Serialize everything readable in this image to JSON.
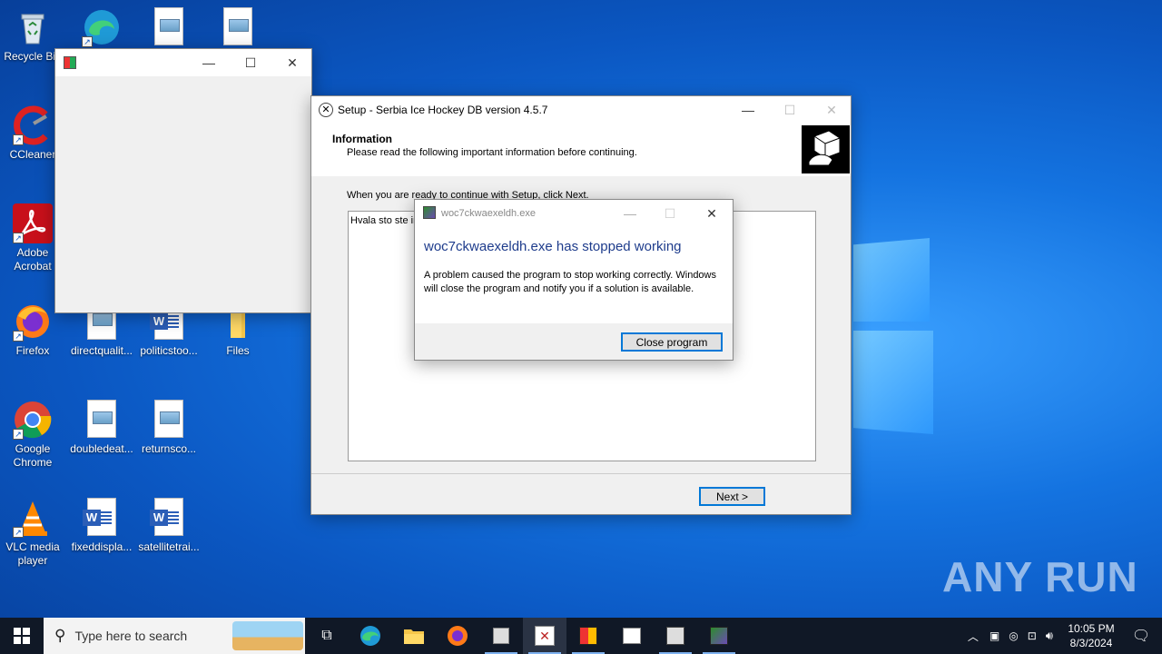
{
  "desktop": {
    "icons": [
      {
        "label": "Recycle Bin",
        "icon": "recycle-bin-icon"
      },
      {
        "label": "CCleaner",
        "icon": "ccleaner-icon"
      },
      {
        "label": "Adobe Acrobat",
        "icon": "adobe-acrobat-icon"
      },
      {
        "label": "Firefox",
        "icon": "firefox-icon"
      },
      {
        "label": "Google Chrome",
        "icon": "chrome-icon"
      },
      {
        "label": "VLC media player",
        "icon": "vlc-icon"
      },
      {
        "label": "directqualit...",
        "icon": "image-file-icon"
      },
      {
        "label": "politicstoo...",
        "icon": "word-doc-icon"
      },
      {
        "label": "Files",
        "icon": "folder-icon"
      },
      {
        "label": "doubledeat...",
        "icon": "image-file-icon"
      },
      {
        "label": "returnsco...",
        "icon": "image-file-icon"
      },
      {
        "label": "fixeddispla...",
        "icon": "word-doc-icon"
      },
      {
        "label": "satellitetrai...",
        "icon": "word-doc-icon"
      }
    ]
  },
  "blank_window": {
    "title": "",
    "controls": {
      "minimize": "—",
      "maximize": "☐",
      "close": "✕"
    }
  },
  "setup_window": {
    "title": "Setup - Serbia Ice Hockey DB version 4.5.7",
    "section_title": "Information",
    "section_subtitle": "Please read the following important information before continuing.",
    "instruction": "When you are ready to continue with Setup, click Next.",
    "info_text": "Hvala sto ste in",
    "next_button": "Next >",
    "controls": {
      "minimize": "—",
      "maximize": "☐",
      "close": "✕"
    }
  },
  "error_dialog": {
    "title": "woc7ckwaexeldh.exe",
    "heading": "woc7ckwaexeldh.exe has stopped working",
    "message": "A problem caused the program to stop working correctly. Windows will close the program and notify you if a solution is available.",
    "close_button": "Close program",
    "controls": {
      "minimize": "—",
      "maximize": "☐",
      "close": "✕"
    }
  },
  "taskbar": {
    "search_placeholder": "Type here to search",
    "clock_time": "10:05 PM",
    "clock_date": "8/3/2024"
  },
  "watermark": {
    "text": "ANY RUN"
  },
  "colors": {
    "accent": "#0078d7",
    "heading_blue": "#1e3c8c",
    "taskbar": "#101826"
  }
}
